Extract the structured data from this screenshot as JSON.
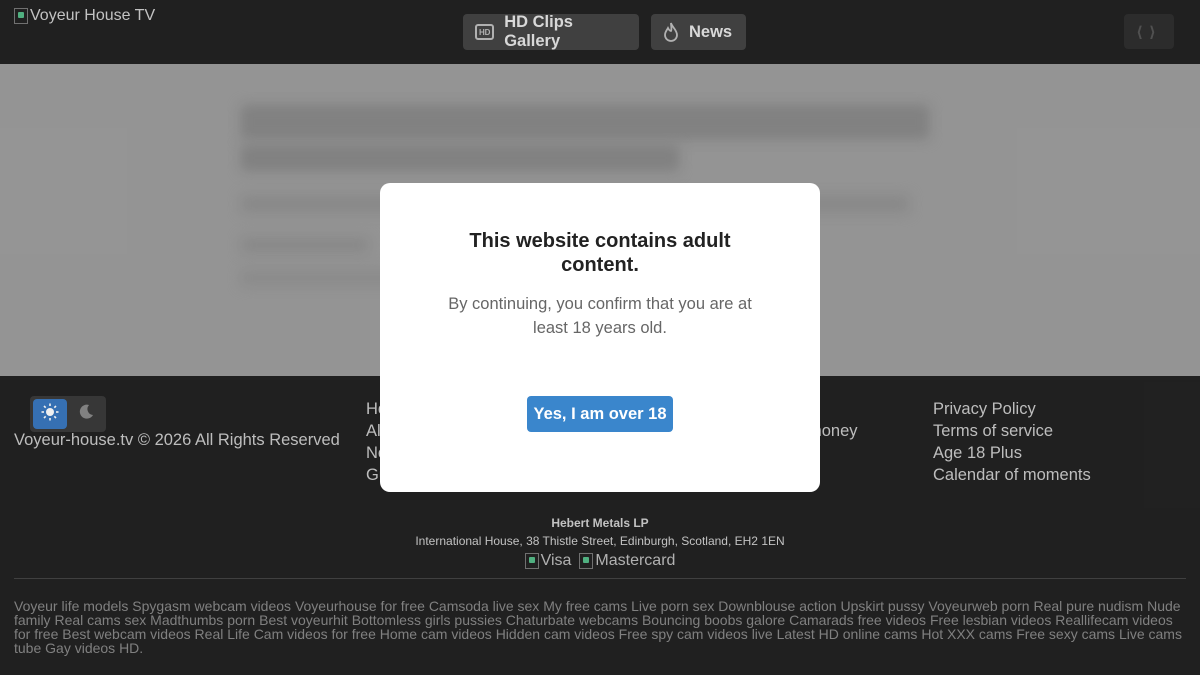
{
  "header": {
    "logo_text": "Voyeur House TV",
    "nav": [
      {
        "label": "HD Clips Gallery",
        "icon": "hd-icon",
        "badge": "HD"
      },
      {
        "label": "News",
        "icon": "fire-icon"
      }
    ],
    "fullscreen_icon": "fullscreen-icon"
  },
  "footer": {
    "theme": {
      "options": [
        "light",
        "dark"
      ],
      "selected": "light"
    },
    "copyright": "Voyeur-house.tv © 2026 All Rights Reserved",
    "col1_links": [
      "Ho",
      "Al",
      "Ne",
      "Gu"
    ],
    "col2_links": [
      "money"
    ],
    "col3_links": [
      "Privacy Policy",
      "Terms of service",
      "Age 18 Plus",
      "Calendar of moments"
    ],
    "company": "Hebert Metals LP",
    "address": "International House, 38 Thistle Street, Edinburgh, Scotland, EH2 1EN",
    "payments": [
      "Visa",
      "Mastercard"
    ],
    "seo_links": [
      "Voyeur life models",
      "Spygasm webcam videos",
      "Voyeurhouse for free",
      "Camsoda live sex",
      "My free cams",
      "Live porn sex",
      "Downblouse action",
      "Upskirt pussy",
      "Voyeurweb porn",
      "Real pure nudism",
      "Nude family",
      "Real cams sex",
      "Madthumbs porn",
      "Best voyeurhit",
      "Bottomless girls pussies",
      "Chaturbate webcams",
      "Bouncing boobs galore",
      "Camarads free videos",
      "Free lesbian videos",
      "Reallifecam videos for free",
      "Best webcam videos",
      "Real Life Cam videos for free",
      "Home cam videos",
      "Hidden cam videos",
      "Free spy cam videos live",
      "Latest HD online cams",
      "Hot XXX cams",
      "Free sexy cams",
      "Live cams tube",
      "Gay videos HD."
    ]
  },
  "modal": {
    "title": "This website contains adult content.",
    "text": "By continuing, you confirm that you are at least 18 years old.",
    "confirm_label": "Yes, I am over 18"
  },
  "colors": {
    "accent": "#3a86cc",
    "header_bg": "#222222",
    "footer_bg": "#232323",
    "blurred_band": "#9e9e9e"
  }
}
